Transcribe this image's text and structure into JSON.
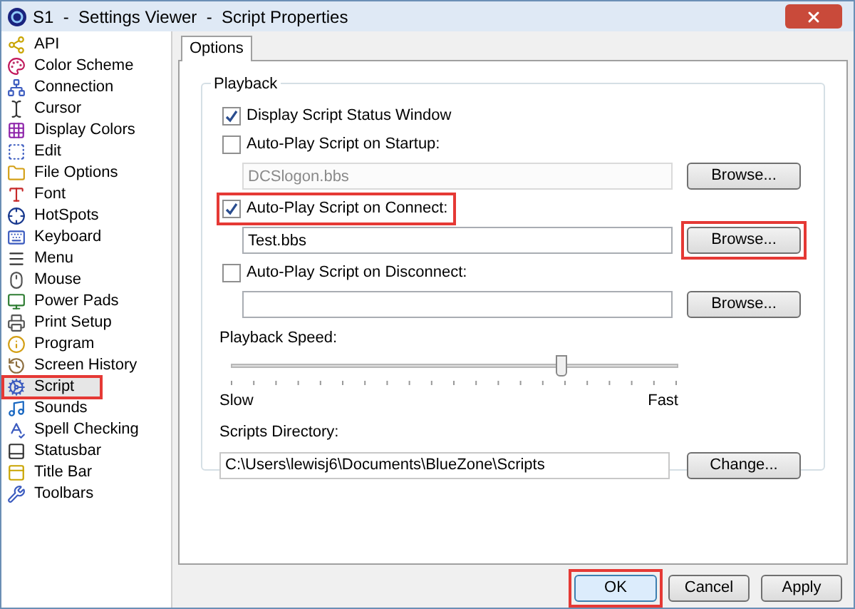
{
  "window": {
    "title": "S1  -  Settings Viewer  -  Script Properties"
  },
  "sidebar": {
    "items": [
      {
        "label": "API",
        "selected": false,
        "highlighted": false
      },
      {
        "label": "Color Scheme",
        "selected": false,
        "highlighted": false
      },
      {
        "label": "Connection",
        "selected": false,
        "highlighted": false
      },
      {
        "label": "Cursor",
        "selected": false,
        "highlighted": false
      },
      {
        "label": "Display Colors",
        "selected": false,
        "highlighted": false
      },
      {
        "label": "Edit",
        "selected": false,
        "highlighted": false
      },
      {
        "label": "File Options",
        "selected": false,
        "highlighted": false
      },
      {
        "label": "Font",
        "selected": false,
        "highlighted": false
      },
      {
        "label": "HotSpots",
        "selected": false,
        "highlighted": false
      },
      {
        "label": "Keyboard",
        "selected": false,
        "highlighted": false
      },
      {
        "label": "Menu",
        "selected": false,
        "highlighted": false
      },
      {
        "label": "Mouse",
        "selected": false,
        "highlighted": false
      },
      {
        "label": "Power Pads",
        "selected": false,
        "highlighted": false
      },
      {
        "label": "Print Setup",
        "selected": false,
        "highlighted": false
      },
      {
        "label": "Program",
        "selected": false,
        "highlighted": false
      },
      {
        "label": "Screen History",
        "selected": false,
        "highlighted": false
      },
      {
        "label": "Script",
        "selected": true,
        "highlighted": true
      },
      {
        "label": "Sounds",
        "selected": false,
        "highlighted": false
      },
      {
        "label": "Spell Checking",
        "selected": false,
        "highlighted": false
      },
      {
        "label": "Statusbar",
        "selected": false,
        "highlighted": false
      },
      {
        "label": "Title Bar",
        "selected": false,
        "highlighted": false
      },
      {
        "label": "Toolbars",
        "selected": false,
        "highlighted": false
      }
    ]
  },
  "tabs": [
    {
      "label": "Options",
      "selected": true
    }
  ],
  "playback": {
    "title": "Playback",
    "rows": [
      {
        "kind": "checkbox",
        "label": "Display Script Status Window",
        "checked": true,
        "highlighted": false
      },
      {
        "kind": "checkbox",
        "label": "Auto-Play Script on Startup:",
        "checked": false,
        "highlighted": false
      },
      {
        "kind": "file",
        "value": "DCSlogon.bbs",
        "disabled": true,
        "button": {
          "label": "Browse...",
          "highlighted": false
        }
      },
      {
        "kind": "checkbox",
        "label": "Auto-Play Script on Connect:",
        "checked": true,
        "highlighted": true
      },
      {
        "kind": "file",
        "value": "Test.bbs",
        "disabled": false,
        "button": {
          "label": "Browse...",
          "highlighted": true
        }
      },
      {
        "kind": "checkbox",
        "label": "Auto-Play Script on Disconnect:",
        "checked": false,
        "highlighted": false
      },
      {
        "kind": "file",
        "disabled": false,
        "button": {
          "label": "Browse...",
          "highlighted": false
        }
      }
    ],
    "speed": {
      "label": "Playback Speed:",
      "level": 0.74,
      "min_label": "Slow",
      "max_label": "Fast"
    },
    "directory": {
      "label": "Scripts Directory:",
      "value": "C:\\Users\\lewisj6\\Documents\\BlueZone\\Scripts",
      "button": {
        "label": "Change...",
        "highlighted": false
      }
    }
  },
  "buttons": [
    {
      "label": "OK",
      "kind": "default",
      "highlighted": true
    },
    {
      "label": "Cancel",
      "kind": "normal",
      "highlighted": false
    },
    {
      "label": "Apply",
      "kind": "normal",
      "highlighted": false
    }
  ]
}
